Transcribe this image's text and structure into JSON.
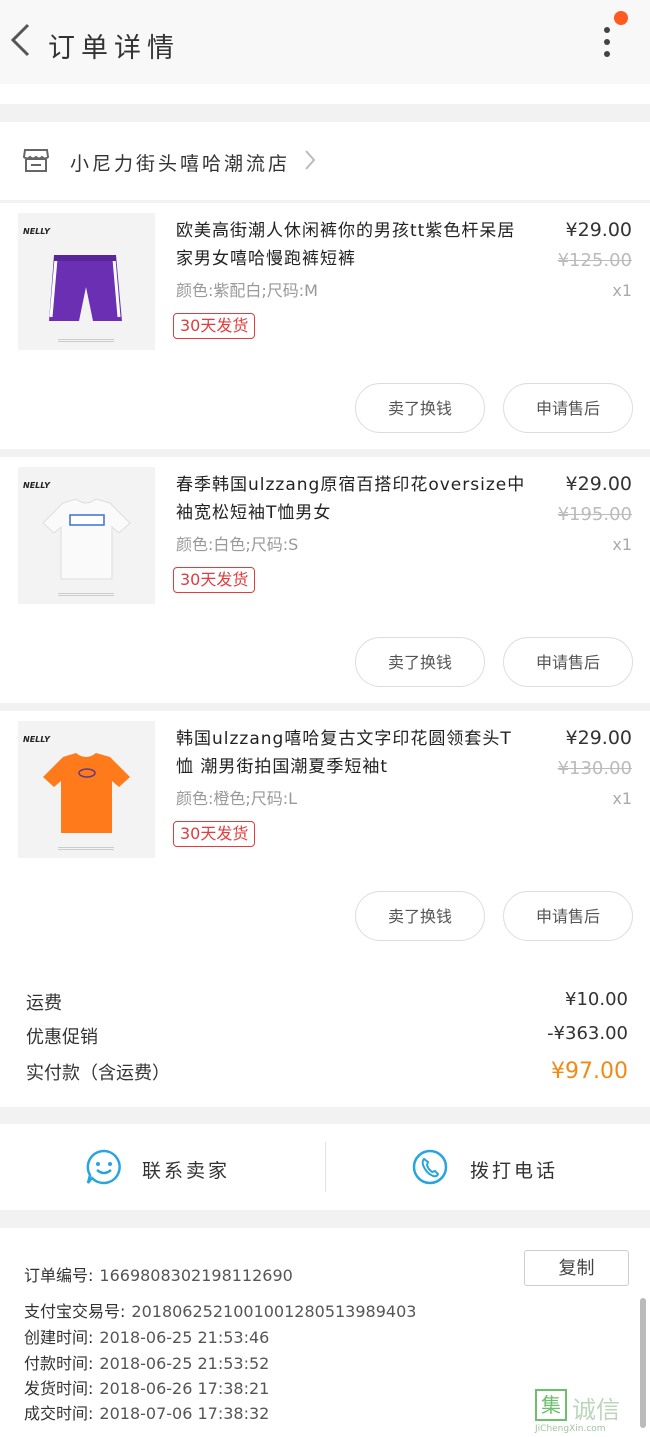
{
  "header": {
    "title": "订单详情",
    "back_icon": "chevron-left-icon",
    "more_icon": "vertical-dots-icon"
  },
  "shop": {
    "name": "小尼力街头嘻哈潮流店",
    "icon": "store-icon",
    "arrow_icon": "chevron-right-icon"
  },
  "items": [
    {
      "name": "欧美高街潮人休闲裤你的男孩tt紫色杆呆居家男女嘻哈慢跑裤短裤",
      "spec": "颜色:紫配白;尺码:M",
      "tag": "30天发货",
      "price": "¥29.00",
      "original_price": "¥125.00",
      "qty": "x1",
      "btn_left": "卖了换钱",
      "btn_right": "申请售后",
      "thumb_brand": "NELLY"
    },
    {
      "name": "春季韩国ulzzang原宿百搭印花oversize中袖宽松短袖T恤男女",
      "spec": "颜色:白色;尺码:S",
      "tag": "30天发货",
      "price": "¥29.00",
      "original_price": "¥195.00",
      "qty": "x1",
      "btn_left": "卖了换钱",
      "btn_right": "申请售后",
      "thumb_brand": "NELLY"
    },
    {
      "name": "韩国ulzzang嘻哈复古文字印花圆领套头T恤 潮男街拍国潮夏季短袖t",
      "spec": "颜色:橙色;尺码:L",
      "tag": "30天发货",
      "price": "¥29.00",
      "original_price": "¥130.00",
      "qty": "x1",
      "btn_left": "卖了换钱",
      "btn_right": "申请售后",
      "thumb_brand": "NELLY"
    }
  ],
  "summary": {
    "shipping_label": "运费",
    "shipping_value": "¥10.00",
    "discount_label": "优惠促销",
    "discount_value": "-¥363.00",
    "total_label": "实付款（含运费）",
    "total_value": "¥97.00"
  },
  "contact": {
    "seller_label": "联系卖家",
    "seller_icon": "chat-smile-icon",
    "phone_label": "拨打电话",
    "phone_icon": "phone-icon"
  },
  "order_info": {
    "order_no_label": "订单编号:",
    "order_no": "1669808302198112690",
    "alipay_label": "支付宝交易号:",
    "alipay_no": "2018062521001001280513989403",
    "created_label": "创建时间:",
    "created": "2018-06-25 21:53:46",
    "paid_label": "付款时间:",
    "paid": "2018-06-25 21:53:52",
    "shipped_label": "发货时间:",
    "shipped": "2018-06-26 17:38:21",
    "done_label": "成交时间:",
    "done": "2018-07-06 17:38:32",
    "copy_label": "复制"
  },
  "watermark": {
    "char": "集",
    "text": "诚信",
    "url": "JiChengXin.com"
  },
  "colors": {
    "accent_orange": "#f08a16",
    "tag_red": "#e23c3c",
    "icon_blue": "#2aa4e0",
    "purple": "#6a2fb3",
    "orange_shirt": "#ff7a1a"
  }
}
